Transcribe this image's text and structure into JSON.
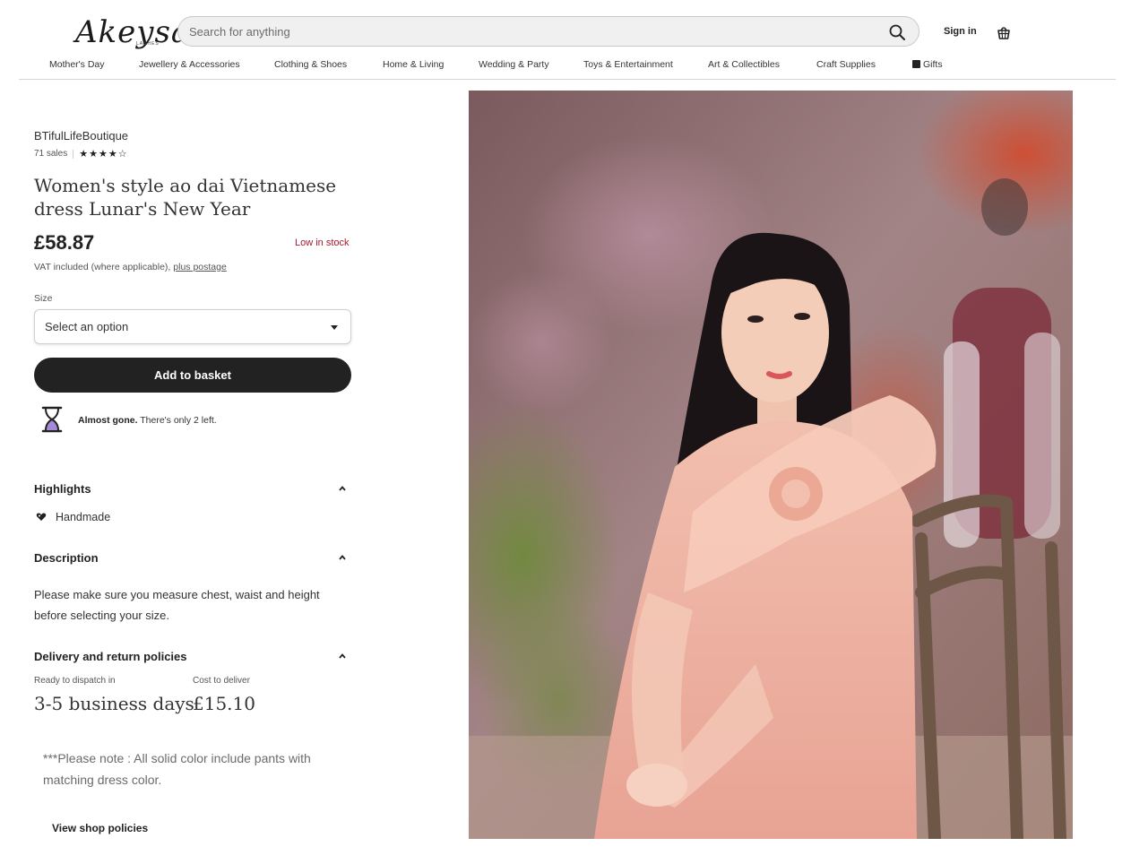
{
  "header": {
    "logo_text": "Akeysa",
    "logo_subtext": "LASHES",
    "search_placeholder": "Search for anything",
    "sign_in": "Sign in"
  },
  "nav": {
    "items": [
      {
        "label": "Mother's Day"
      },
      {
        "label": "Jewellery & Accessories"
      },
      {
        "label": "Clothing & Shoes"
      },
      {
        "label": "Home & Living"
      },
      {
        "label": "Wedding & Party"
      },
      {
        "label": "Toys & Entertainment"
      },
      {
        "label": "Art & Collectibles"
      },
      {
        "label": "Craft Supplies"
      },
      {
        "label": "Gifts"
      }
    ]
  },
  "product": {
    "shop_name": "BTifulLifeBoutique",
    "sales": "71 sales",
    "rating_stars": "★★★★☆",
    "rating": 4,
    "title": "Women's style ao dai Vietnamese dress Lunar's New Year",
    "price": "£58.87",
    "stock_status": "Low in stock",
    "vat_text": "VAT included (where applicable),",
    "vat_link": "plus postage",
    "size_label": "Size",
    "size_selected": "Select an option",
    "add_to_basket": "Add to basket",
    "almost_gone_bold": "Almost gone.",
    "almost_gone_rest": " There's only 2 left."
  },
  "highlights": {
    "heading": "Highlights",
    "items": [
      "Handmade"
    ]
  },
  "description": {
    "heading": "Description",
    "text": "Please make sure you measure chest, waist and height before selecting your size."
  },
  "delivery": {
    "heading": "Delivery and return policies",
    "dispatch_label": "Ready to dispatch in",
    "dispatch_value": "3-5 business days",
    "cost_label": "Cost to deliver",
    "cost_value": "£15.10"
  },
  "note": "***Please note : All solid color include pants with matching dress color.",
  "view_shop_policies": "View shop policies",
  "colors": {
    "stock_red": "#a61a2e",
    "button_dark": "#222222"
  }
}
